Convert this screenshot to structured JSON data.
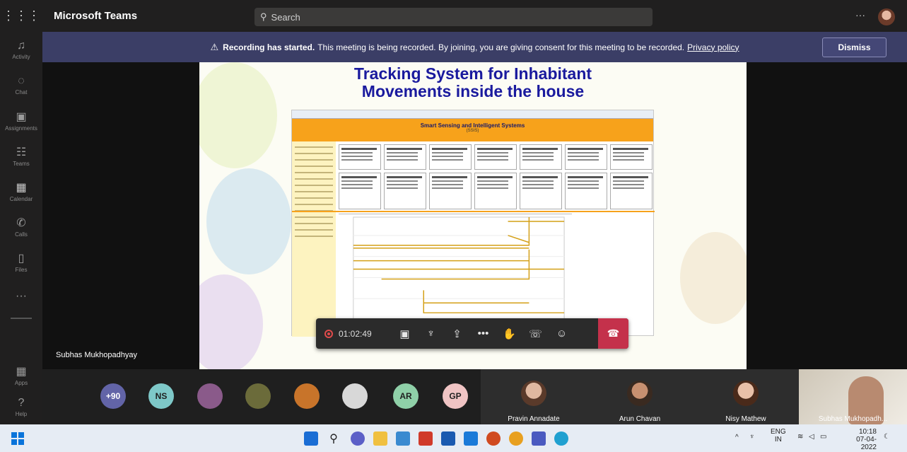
{
  "titlebar": {
    "app_name": "Microsoft Teams",
    "search_placeholder": "Search",
    "more_label": "···"
  },
  "rail": {
    "items": [
      {
        "label": "Activity",
        "icon": "bell-icon"
      },
      {
        "label": "Chat",
        "icon": "chat-icon"
      },
      {
        "label": "Assignments",
        "icon": "assignments-icon"
      },
      {
        "label": "Teams",
        "icon": "teams-icon"
      },
      {
        "label": "Calendar",
        "icon": "calendar-icon"
      },
      {
        "label": "Calls",
        "icon": "phone-icon"
      },
      {
        "label": "Files",
        "icon": "file-icon"
      },
      {
        "label": "···",
        "icon": "more-icon"
      },
      {
        "label": "Apps",
        "icon": "apps-icon"
      },
      {
        "label": "Help",
        "icon": "help-icon"
      }
    ]
  },
  "banner": {
    "bold_text": "Recording has started.",
    "text": "This meeting is being recorded. By joining, you are giving consent for this meeting to be recorded.",
    "link": "Privacy policy",
    "dismiss_label": "Dismiss"
  },
  "slide": {
    "title_line1": "Tracking System for Inhabitant",
    "title_line2": "Movements inside the house",
    "embedded_header": "Smart Sensing and Intelligent Systems",
    "embedded_sub": "(SSIS)"
  },
  "presenter": {
    "name": "Subhas Mukhopadhyay"
  },
  "controls": {
    "timer": "01:02:49"
  },
  "participants": {
    "overflow_count": "+90",
    "avatars": [
      {
        "initials": "NS",
        "color": "#7ec8c8"
      },
      {
        "initials": "",
        "color": "#8a5a8a"
      },
      {
        "initials": "",
        "color": "#6b6b3a"
      },
      {
        "initials": "",
        "color": "#c8742a"
      },
      {
        "initials": "",
        "color": "#d8d8d8"
      },
      {
        "initials": "AR",
        "color": "#8fd0a8"
      },
      {
        "initials": "GP",
        "color": "#f0c4c4"
      }
    ],
    "tiles": [
      {
        "name": "Pravin Annadate"
      },
      {
        "name": "Arun Chavan"
      },
      {
        "name": "Nisy Mathew"
      },
      {
        "name": "Subhas Mukhopadh..."
      }
    ]
  },
  "taskbar": {
    "lang": "ENG",
    "region": "IN",
    "time": "10:18",
    "date": "07-04-2022"
  }
}
